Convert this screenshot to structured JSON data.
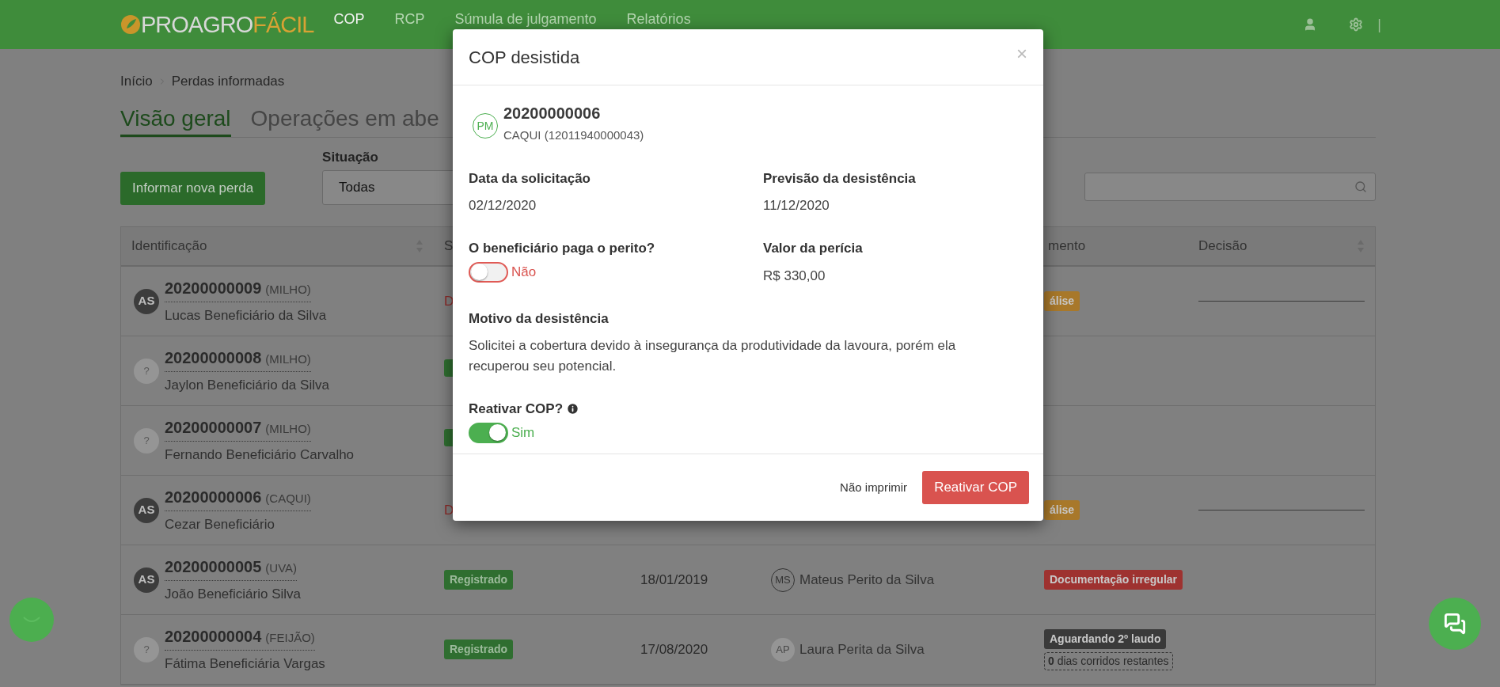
{
  "nav": {
    "logo": {
      "first": "PROAGRO",
      "second": "FÁCIL"
    },
    "items": [
      {
        "label": "COP",
        "selected": true
      },
      {
        "label": "RCP",
        "selected": false
      },
      {
        "label": "Súmula de julgamento",
        "selected": false
      },
      {
        "label": "Relatórios",
        "selected": false
      }
    ],
    "separator": "|"
  },
  "breadcrumb": [
    "Início",
    "Perdas informadas"
  ],
  "tabs": [
    {
      "label": "Visão geral",
      "selected": true
    },
    {
      "label": "Operações em abe",
      "selected": false
    }
  ],
  "new_loss_button": "Informar nova perda",
  "filter": {
    "label": "Situação",
    "value": "Todas"
  },
  "table": {
    "columns": {
      "identification": "Identificação",
      "status": "S",
      "documentation": "mento",
      "decision": "Decisão"
    },
    "rows": [
      {
        "number": "20200000009",
        "crop": "(MILHO)",
        "name": "Lucas Beneficiário da Silva",
        "avatar": {
          "kind": "initials",
          "text": "AS"
        },
        "status": {
          "kind": "text",
          "text": "D"
        },
        "documentation": [
          {
            "kind": "badge",
            "color": "#a8782a",
            "text": "álise"
          }
        ],
        "decision_pending": true
      },
      {
        "number": "20200000008",
        "crop": "(MILHO)",
        "name": "Jaylon Beneficiário da Silva",
        "avatar": {
          "kind": "unknown",
          "text": "?"
        },
        "status": {
          "kind": "badge"
        },
        "documentation": [],
        "decision_pending": false
      },
      {
        "number": "20200000007",
        "crop": "(MILHO)",
        "name": "Fernando Beneficiário Carvalho",
        "avatar": {
          "kind": "unknown",
          "text": "?"
        },
        "status": {
          "kind": "badge"
        },
        "documentation": [],
        "decision_pending": false
      },
      {
        "number": "20200000006",
        "crop": "(CAQUI)",
        "name": "Cezar Beneficiário",
        "avatar": {
          "kind": "initials",
          "text": "AS"
        },
        "status": {
          "kind": "text",
          "text": "D"
        },
        "documentation": [
          {
            "kind": "badge",
            "color": "#a8782a",
            "text": "álise"
          }
        ],
        "decision_pending": true
      },
      {
        "number": "20200000005",
        "crop": "(UVA)",
        "name": "João Beneficiário Silva",
        "avatar": {
          "kind": "initials",
          "text": "AS"
        },
        "status": {
          "kind": "badge",
          "text": "Registrado"
        },
        "date": "18/01/2019",
        "expert": {
          "kind": "outline",
          "initials": "MS",
          "name": "Mateus Perito da Silva"
        },
        "documentation": [
          {
            "kind": "badge",
            "color": "#9e3230",
            "text": "Documentação irregular"
          }
        ],
        "decision_pending": false
      },
      {
        "number": "20200000004",
        "crop": "(FEIJÃO)",
        "name": "Fátima Beneficiária Vargas",
        "avatar": {
          "kind": "unknown",
          "text": "?"
        },
        "status": {
          "kind": "badge",
          "text": "Registrado"
        },
        "date": "17/08/2020",
        "expert": {
          "kind": "filled",
          "initials": "AP",
          "name": "Laura Perita da Silva"
        },
        "documentation": [
          {
            "kind": "badge",
            "color": "#3a3a3a",
            "text": "Aguardando 2º laudo"
          },
          {
            "kind": "countdown",
            "text": "**0** dias corridos restantes"
          }
        ],
        "decision_pending": false
      }
    ]
  },
  "modal": {
    "title": "COP desistida",
    "close": "×",
    "record": {
      "avatar": "PM",
      "number": "20200000006",
      "detail": "CAQUI (12011940000043)"
    },
    "rows": [
      [
        {
          "kind": "text",
          "label": "Data da solicitação",
          "value": "02/12/2020"
        },
        {
          "kind": "text",
          "label": "Previsão da desistência",
          "value": "11/12/2020"
        }
      ],
      [
        {
          "kind": "toggle",
          "label": "O beneficiário paga o perito?",
          "on": false,
          "state_label": "Não",
          "info": false
        },
        {
          "kind": "text",
          "label": "Valor da perícia",
          "value": "R$ 330,00"
        }
      ],
      [
        {
          "kind": "text",
          "label": "Motivo da desistência",
          "value": "Solicitei a cobertura devido à insegurança da produtividade da lavoura, porém ela recuperou seu potencial."
        }
      ],
      [
        {
          "kind": "toggle",
          "label": "Reativar COP?",
          "on": true,
          "state_label": "Sim",
          "info": true
        }
      ]
    ],
    "secondary_button": "Não imprimir",
    "primary_button": "Reativar COP"
  }
}
